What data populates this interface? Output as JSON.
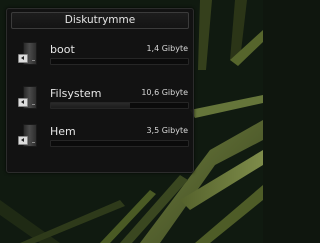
{
  "widget": {
    "title": "Diskutrymme",
    "disks": [
      {
        "name": "boot",
        "size": "1,4 Gibyte",
        "usage_fraction": 0.0
      },
      {
        "name": "Filsystem",
        "size": "10,6 Gibyte",
        "usage_fraction": 0.58
      },
      {
        "name": "Hem",
        "size": "3,5 Gibyte",
        "usage_fraction": 0.0
      }
    ]
  },
  "icons": {
    "drive": "hard-drive-icon",
    "mount": "mount-arrow-icon"
  },
  "colors": {
    "panel": "#121212",
    "text": "#e6e6e6",
    "wallpaper": "#0f160e",
    "grass": "#6a7a3a"
  }
}
